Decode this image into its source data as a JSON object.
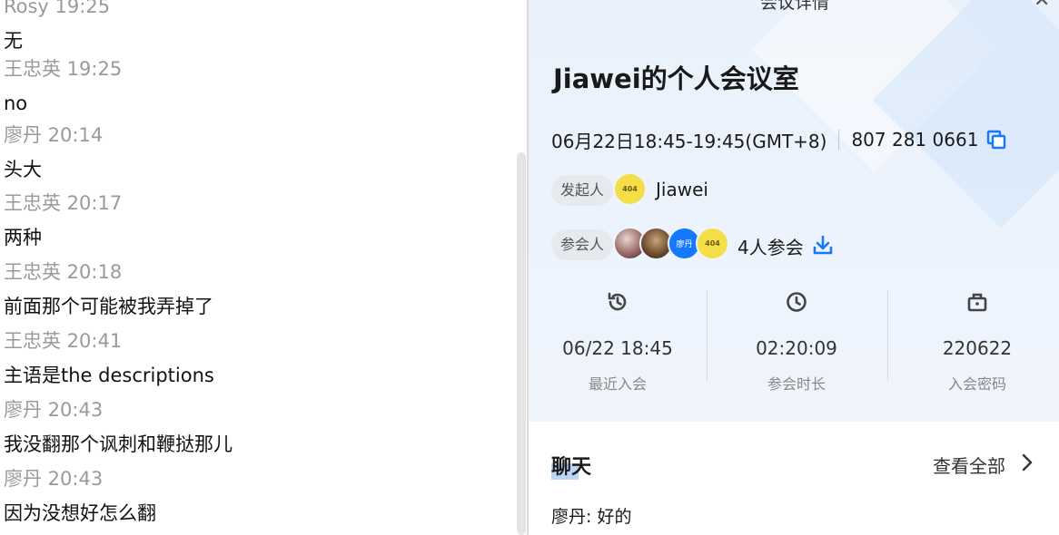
{
  "chat": {
    "messages": [
      {
        "meta": "Rosy 19:25",
        "text": "无"
      },
      {
        "meta": "王忠英 19:25",
        "text": "no"
      },
      {
        "meta": "廖丹 20:14",
        "text": "头大"
      },
      {
        "meta": "王忠英 20:17",
        "text": "两种"
      },
      {
        "meta": "王忠英 20:18",
        "text": "前面那个可能被我弄掉了"
      },
      {
        "meta": "王忠英 20:41",
        "text": "主语是the descriptions"
      },
      {
        "meta": "廖丹 20:43",
        "text": "我没翻那个讽刺和鞭挞那儿"
      },
      {
        "meta": "廖丹 20:43",
        "text": "因为没想好怎么翻"
      }
    ]
  },
  "detail": {
    "header_title": "会议详情",
    "close_icon": "close-icon",
    "room_title": "Jiawei的个人会议室",
    "time_range": "06月22日18:45-19:45(GMT+8)",
    "meeting_id": "807 281 0661",
    "host_tag": "发起人",
    "host_name": "Jiawei",
    "host_avatar_text": "404",
    "participants_tag": "参会人",
    "participant_blue_avatar_text": "廖丹",
    "participant_yellow_avatar_text": "404",
    "participant_count": "4人参会",
    "stats": [
      {
        "icon": "history-icon",
        "value": "06/22 18:45",
        "label": "最近入会"
      },
      {
        "icon": "clock-icon",
        "value": "02:20:09",
        "label": "参会时长"
      },
      {
        "icon": "lock-icon",
        "value": "220622",
        "label": "入会密码"
      }
    ],
    "chat_section": {
      "title": "聊天",
      "see_all": "查看全部",
      "last_message": "廖丹: 好的"
    },
    "colors": {
      "accent": "#1677ff",
      "panel_bg": "#eef4fd"
    }
  }
}
